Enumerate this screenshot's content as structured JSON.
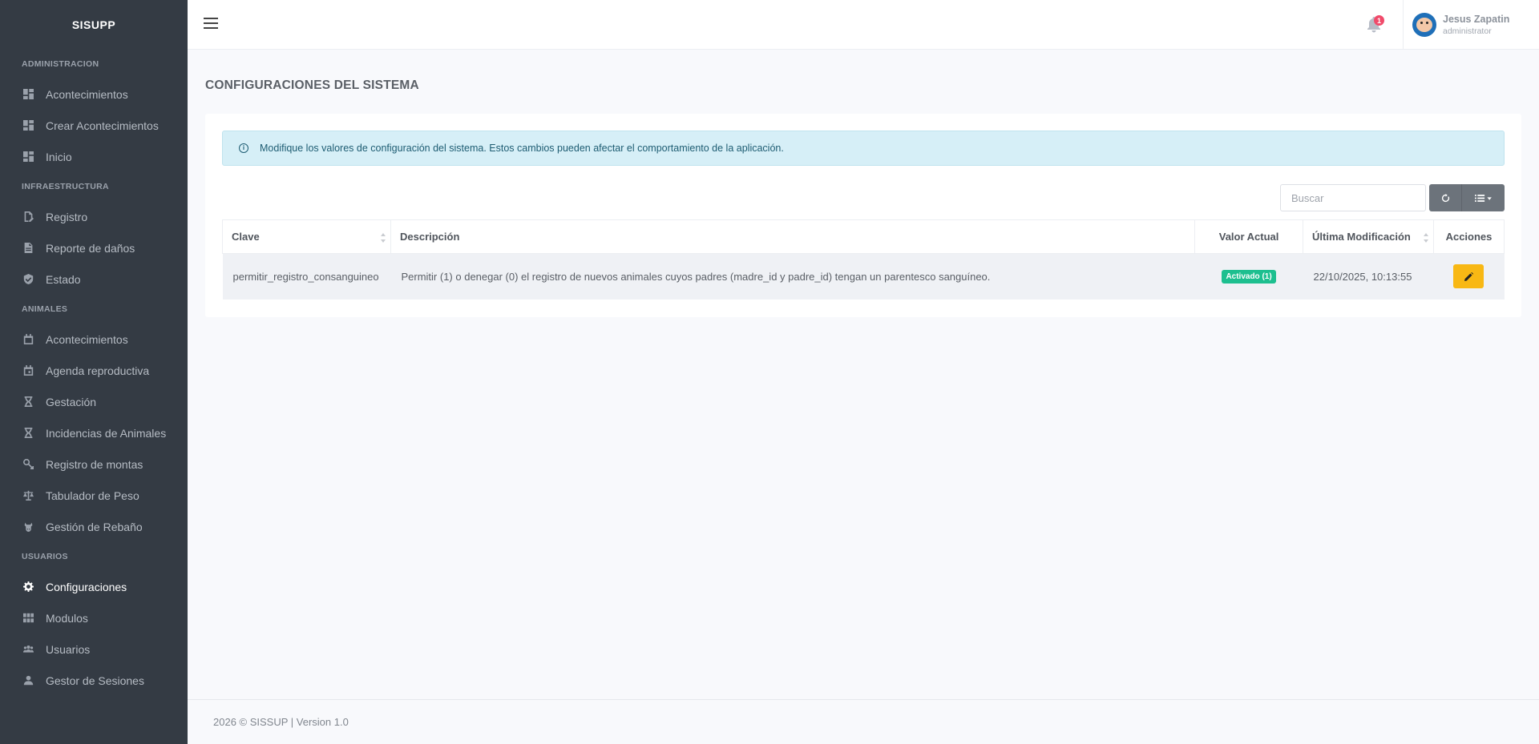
{
  "sidebar": {
    "brand": "SISUPP",
    "sections": [
      {
        "title": "ADMINISTRACION",
        "items": [
          {
            "label": "Acontecimientos",
            "icon": "dashboard-icon"
          },
          {
            "label": "Crear Acontecimientos",
            "icon": "dashboard-icon"
          },
          {
            "label": "Inicio",
            "icon": "dashboard-icon"
          }
        ]
      },
      {
        "title": "INFRAESTRUCTURA",
        "items": [
          {
            "label": "Registro",
            "icon": "document-edit-icon"
          },
          {
            "label": "Reporte de daños",
            "icon": "document-icon"
          },
          {
            "label": "Estado",
            "icon": "shield-check-icon"
          }
        ]
      },
      {
        "title": "ANIMALES",
        "items": [
          {
            "label": "Acontecimientos",
            "icon": "calendar-icon"
          },
          {
            "label": "Agenda reproductiva",
            "icon": "calendar-icon"
          },
          {
            "label": "Gestación",
            "icon": "hourglass-icon"
          },
          {
            "label": "Incidencias de Animales",
            "icon": "hourglass-icon"
          },
          {
            "label": "Registro de montas",
            "icon": "gender-icon"
          },
          {
            "label": "Tabulador de Peso",
            "icon": "scale-icon"
          },
          {
            "label": "Gestión de Rebaño",
            "icon": "cow-icon"
          }
        ]
      },
      {
        "title": "USUARIOS",
        "items": [
          {
            "label": "Configuraciones",
            "icon": "gear-icon",
            "active": true
          },
          {
            "label": "Modulos",
            "icon": "grid-icon"
          },
          {
            "label": "Usuarios",
            "icon": "users-icon"
          },
          {
            "label": "Gestor de Sesiones",
            "icon": "user-icon"
          }
        ]
      }
    ]
  },
  "topbar": {
    "notification_count": "1",
    "user_name": "Jesus Zapatin",
    "user_role": "administrator"
  },
  "page": {
    "title": "CONFIGURACIONES DEL SISTEMA",
    "alert": "Modifique los valores de configuración del sistema. Estos cambios pueden afectar el comportamiento de la aplicación.",
    "search_placeholder": "Buscar"
  },
  "table": {
    "headers": {
      "clave": "Clave",
      "descripcion": "Descripción",
      "valor": "Valor Actual",
      "modificacion": "Última Modificación",
      "acciones": "Acciones"
    },
    "rows": [
      {
        "clave": "permitir_registro_consanguineo",
        "descripcion": "Permitir (1) o denegar (0) el registro de nuevos animales cuyos padres (madre_id y padre_id) tengan un parentesco sanguíneo.",
        "valor": "Activado (1)",
        "modificacion": "22/10/2025, 10:13:55"
      }
    ]
  },
  "footer": {
    "text": "2026 © SISSUP | Version 1.0"
  },
  "colors": {
    "sidebar_bg": "#343b44",
    "active_badge": "#1dbf8f",
    "edit_button": "#f8b814",
    "alert_bg": "#d6eff7"
  }
}
